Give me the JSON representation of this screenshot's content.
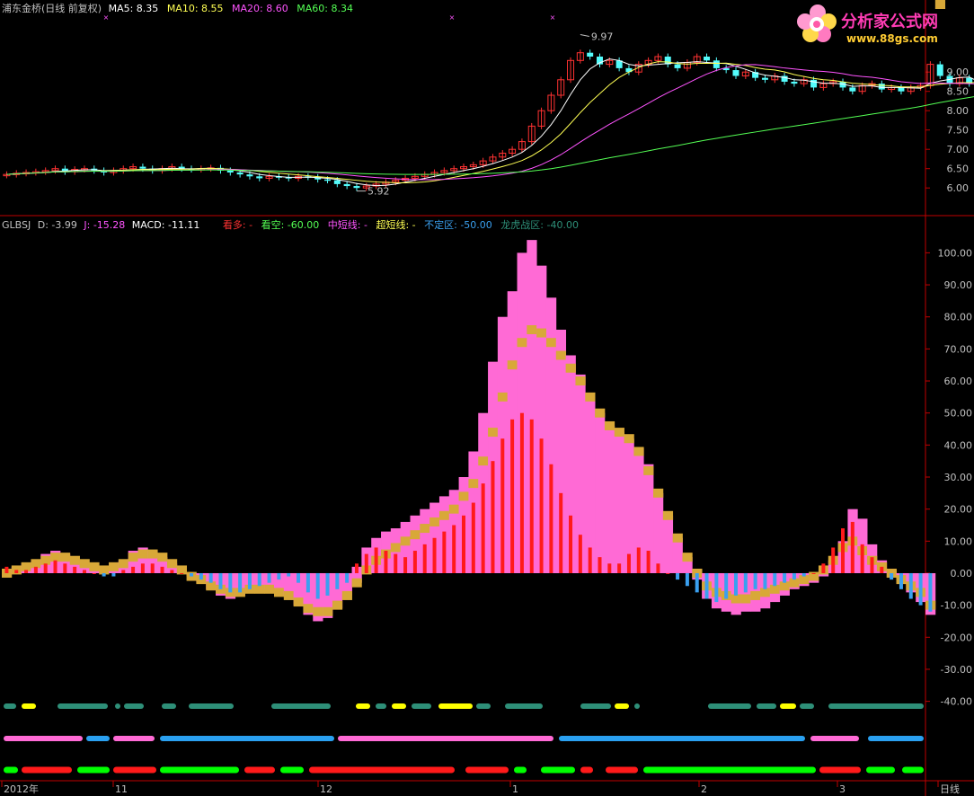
{
  "upper_header": {
    "title": "浦东金桥(日线 前复权)",
    "ma5": "MA5: 8.35",
    "ma10": "MA10: 8.55",
    "ma20": "MA20: 8.60",
    "ma60": "MA60: 8.34"
  },
  "lower_header": {
    "indicator": "GLBSJ",
    "d": "D: -3.99",
    "j": "J: -15.28",
    "macd": "MACD: -11.11",
    "long": "看多: -",
    "short": "看空: -60.00",
    "mid": "中短线: -",
    "ultra": "超短线: -",
    "neutral": "不定区: -50.00",
    "battle": "龙虎战区: -40.00"
  },
  "logo": {
    "text": "分析家公式网",
    "url": "www.88gs.com"
  },
  "colors": {
    "up": "#ff3232",
    "down": "#54fcfc",
    "ma5": "#ffffff",
    "ma10": "#ffff54",
    "ma20": "#ff54ff",
    "ma60": "#54ff54",
    "axis": "#c00000",
    "pink": "#ff6ad5",
    "gold": "#d8a838",
    "macd_up": "#ff1a1a",
    "macd_down": "#3aa0f0",
    "teal": "#2e8f78",
    "yellow": "#ffff00",
    "blue": "#2aa0f0",
    "green": "#00ff00"
  },
  "chart_data": [
    {
      "type": "candlestick",
      "title": "浦东金桥(日线 前复权)",
      "ylim": [
        5.4,
        10.4
      ],
      "y_ticks": [
        "9.00",
        "8.50",
        "8.00",
        "7.50",
        "7.00",
        "6.50",
        "6.00"
      ],
      "annotations": [
        {
          "label": "9.97",
          "value": 9.97
        },
        {
          "label": "5.92",
          "value": 5.92
        }
      ],
      "closes": [
        6.35,
        6.38,
        6.4,
        6.42,
        6.45,
        6.5,
        6.42,
        6.48,
        6.5,
        6.45,
        6.4,
        6.45,
        6.5,
        6.55,
        6.5,
        6.45,
        6.5,
        6.55,
        6.5,
        6.48,
        6.5,
        6.52,
        6.45,
        6.4,
        6.35,
        6.3,
        6.25,
        6.3,
        6.28,
        6.25,
        6.3,
        6.28,
        6.22,
        6.2,
        6.1,
        6.05,
        6.0,
        6.05,
        6.1,
        6.15,
        6.2,
        6.25,
        6.3,
        6.35,
        6.4,
        6.45,
        6.5,
        6.55,
        6.6,
        6.7,
        6.8,
        6.9,
        7.0,
        7.2,
        7.6,
        8.0,
        8.4,
        8.8,
        9.3,
        9.5,
        9.4,
        9.2,
        9.3,
        9.1,
        9.0,
        9.2,
        9.3,
        9.4,
        9.2,
        9.1,
        9.25,
        9.4,
        9.3,
        9.1,
        9.05,
        8.9,
        9.0,
        8.85,
        8.8,
        8.9,
        8.75,
        8.7,
        8.8,
        8.6,
        8.7,
        8.75,
        8.6,
        8.5,
        8.65,
        8.7,
        8.55,
        8.6,
        8.5,
        8.6,
        8.65,
        9.2,
        8.9,
        8.7,
        8.85,
        8.7,
        8.6,
        8.5,
        8.3,
        8.2
      ],
      "ma_lines": [
        "MA5",
        "MA10",
        "MA20",
        "MA60"
      ]
    },
    {
      "type": "bar",
      "title": "GLBSJ",
      "ylim": [
        -23,
        106
      ],
      "y_ticks": [
        "100.00",
        "90.00",
        "80.00",
        "70.00",
        "60.00",
        "50.00",
        "40.00",
        "30.00",
        "20.00",
        "10.00",
        "0.00",
        "-10.00",
        "-20.00",
        "-30.00",
        "-40.00"
      ],
      "x_ticks": [
        "2012年",
        "11",
        "12",
        "1",
        "2",
        "3",
        "日线"
      ],
      "macd": [
        2,
        1,
        1,
        2,
        3,
        4,
        3,
        2,
        1,
        0,
        -1,
        -1,
        1,
        2,
        3,
        3,
        2,
        1,
        0,
        -1,
        -2,
        -3,
        -5,
        -6,
        -6,
        -5,
        -4,
        -3,
        -2,
        -1,
        -3,
        -6,
        -8,
        -7,
        -5,
        -3,
        3,
        6,
        8,
        7,
        6,
        5,
        7,
        9,
        11,
        13,
        15,
        18,
        22,
        28,
        35,
        42,
        48,
        50,
        48,
        42,
        34,
        25,
        18,
        12,
        8,
        5,
        3,
        3,
        6,
        8,
        7,
        3,
        0,
        -2,
        -4,
        -6,
        -8,
        -9,
        -8,
        -7,
        -6,
        -5,
        -5,
        -4,
        -3,
        -2,
        -1,
        0,
        3,
        8,
        14,
        16,
        9,
        5,
        2,
        -2,
        -5,
        -8,
        -10,
        -12
      ],
      "j_line": [
        1,
        2,
        3,
        4,
        6,
        7,
        6,
        4,
        3,
        2,
        1,
        2,
        4,
        7,
        8,
        7,
        5,
        3,
        1,
        -1,
        -3,
        -5,
        -7,
        -8,
        -7,
        -5,
        -4,
        -4,
        -5,
        -7,
        -10,
        -13,
        -15,
        -14,
        -11,
        -6,
        2,
        8,
        11,
        13,
        14,
        16,
        18,
        20,
        22,
        24,
        26,
        30,
        38,
        50,
        66,
        80,
        88,
        100,
        104,
        96,
        86,
        76,
        68,
        62,
        55,
        45,
        38,
        35,
        40,
        39,
        34,
        25,
        18,
        10,
        4,
        -2,
        -8,
        -11,
        -12,
        -13,
        -12,
        -12,
        -11,
        -9,
        -7,
        -5,
        -4,
        -3,
        -1,
        3,
        10,
        20,
        17,
        9,
        4,
        1,
        -3,
        -6,
        -9,
        -13,
        -15
      ],
      "d_line": [
        0,
        1,
        2,
        3,
        4,
        5,
        5,
        4,
        3,
        2,
        1,
        2,
        3,
        5,
        6,
        6,
        5,
        3,
        1,
        -1,
        -2,
        -4,
        -5,
        -6,
        -6,
        -5,
        -5,
        -5,
        -6,
        -7,
        -9,
        -11,
        -12,
        -12,
        -10,
        -7,
        -3,
        1,
        4,
        6,
        8,
        10,
        12,
        14,
        16,
        18,
        20,
        24,
        28,
        35,
        44,
        55,
        65,
        72,
        76,
        75,
        72,
        68,
        64,
        60,
        55,
        50,
        46,
        44,
        42,
        38,
        32,
        25,
        18,
        11,
        5,
        0,
        -4,
        -6,
        -7,
        -8,
        -8,
        -7,
        -6,
        -5,
        -4,
        -3,
        -2,
        -1,
        1,
        4,
        8,
        10,
        7,
        4,
        2,
        0,
        -2,
        -4,
        -6,
        -10
      ],
      "band_battle": "龙虎战区 -40",
      "band_neutral": "不定区 -50",
      "band_short": "看空 -60"
    }
  ]
}
